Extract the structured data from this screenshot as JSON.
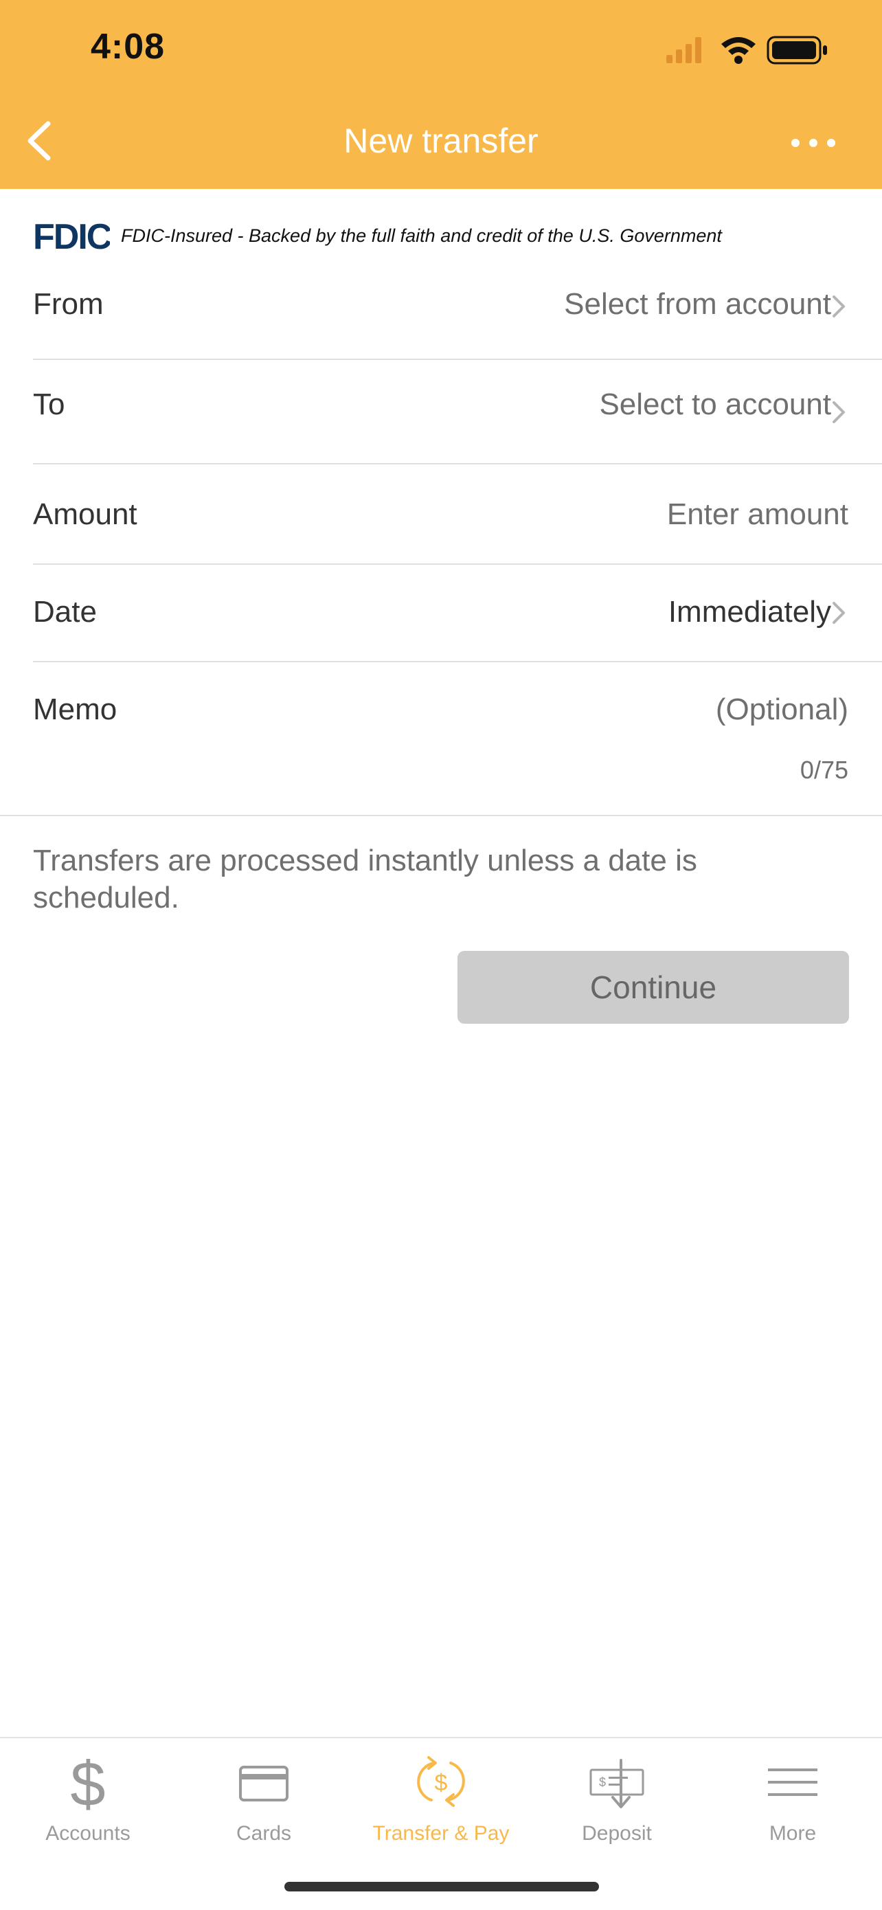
{
  "status_bar": {
    "time": "4:08"
  },
  "nav": {
    "title": "New transfer"
  },
  "fdic": {
    "logo_text": "FDIC",
    "text": "FDIC-Insured - Backed by the full faith and credit of the U.S. Government"
  },
  "form": {
    "from": {
      "label": "From",
      "value": "Select from account"
    },
    "to": {
      "label": "To",
      "value": "Select to account"
    },
    "amount": {
      "label": "Amount",
      "placeholder": "Enter amount"
    },
    "date": {
      "label": "Date",
      "value": "Immediately"
    },
    "memo": {
      "label": "Memo",
      "placeholder": "(Optional)",
      "counter": "0/75"
    }
  },
  "info_text": "Transfers are processed instantly unless a date is scheduled.",
  "continue_label": "Continue",
  "tabs": [
    {
      "label": "Accounts",
      "icon": "dollar-icon"
    },
    {
      "label": "Cards",
      "icon": "card-icon"
    },
    {
      "label": "Transfer & Pay",
      "icon": "transfer-pay-icon",
      "active": true
    },
    {
      "label": "Deposit",
      "icon": "check-deposit-icon"
    },
    {
      "label": "More",
      "icon": "menu-icon"
    }
  ],
  "colors": {
    "brand": "#f9b84a",
    "fdic_navy": "#0f3661",
    "button_disabled": "#cccccc",
    "text_secondary": "#6f6f6f"
  }
}
